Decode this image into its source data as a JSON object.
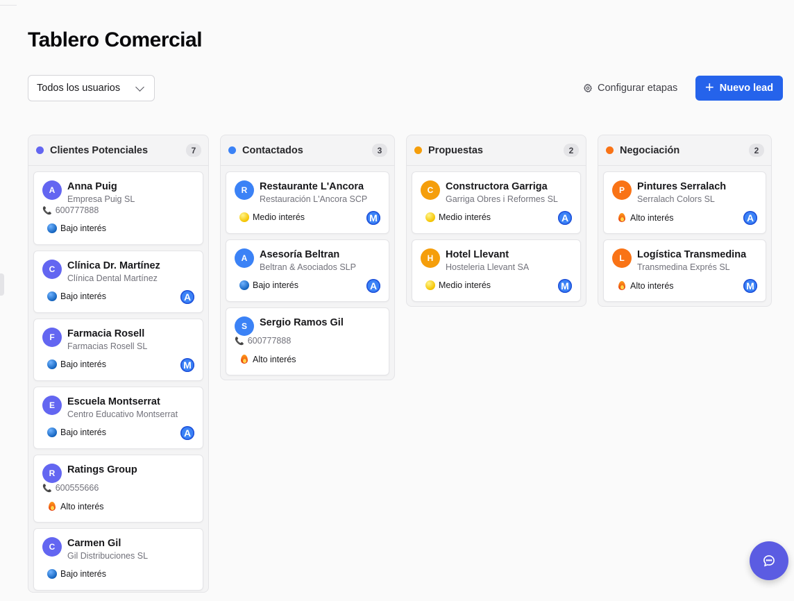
{
  "page": {
    "title": "Tablero Comercial"
  },
  "toolbar": {
    "user_filter": "Todos los usuarios",
    "configure_label": "Configurar etapas",
    "new_lead_label": "Nuevo lead"
  },
  "colors": {
    "primary": "#2563eb",
    "stage_prospects": "#6366f1",
    "stage_contacted": "#3b82f6",
    "stage_proposals": "#f59e0b",
    "stage_negotiation": "#f97316"
  },
  "columns": [
    {
      "title": "Clientes Potenciales",
      "count": "7",
      "cards": [
        {
          "initial": "A",
          "name": "Anna Puig",
          "company": "Empresa Puig SL",
          "phone": "600777888",
          "interest": "Bajo interés",
          "interest_icon": "blue-circle",
          "owner": ""
        },
        {
          "initial": "C",
          "name": "Clínica Dr. Martínez",
          "company": "Clínica Dental Martínez",
          "phone": "",
          "interest": "Bajo interés",
          "interest_icon": "blue-circle",
          "owner": "A"
        },
        {
          "initial": "F",
          "name": "Farmacia Rosell",
          "company": "Farmacias Rosell SL",
          "phone": "",
          "interest": "Bajo interés",
          "interest_icon": "blue-circle",
          "owner": "M"
        },
        {
          "initial": "E",
          "name": "Escuela Montserrat",
          "company": "Centro Educativo Montserrat",
          "phone": "",
          "interest": "Bajo interés",
          "interest_icon": "blue-circle",
          "owner": "A"
        },
        {
          "initial": "R",
          "name": "Ratings Group",
          "company": "",
          "phone": "600555666",
          "interest": "Alto interés",
          "interest_icon": "fire",
          "owner": ""
        },
        {
          "initial": "C",
          "name": "Carmen Gil",
          "company": "Gil Distribuciones SL",
          "phone": "",
          "interest": "Bajo interés",
          "interest_icon": "blue-circle",
          "owner": ""
        }
      ]
    },
    {
      "title": "Contactados",
      "count": "3",
      "cards": [
        {
          "initial": "R",
          "name": "Restaurante L'Ancora",
          "company": "Restauración L'Ancora SCP",
          "phone": "",
          "interest": "Medio interés",
          "interest_icon": "yellow-circle",
          "owner": "M"
        },
        {
          "initial": "A",
          "name": "Asesoría Beltran",
          "company": "Beltran & Asociados SLP",
          "phone": "",
          "interest": "Bajo interés",
          "interest_icon": "blue-circle",
          "owner": "A"
        },
        {
          "initial": "S",
          "name": "Sergio Ramos Gil",
          "company": "",
          "phone": "600777888",
          "interest": "Alto interés",
          "interest_icon": "fire",
          "owner": ""
        }
      ]
    },
    {
      "title": "Propuestas",
      "count": "2",
      "cards": [
        {
          "initial": "C",
          "name": "Constructora Garriga",
          "company": "Garriga Obres i Reformes SL",
          "phone": "",
          "interest": "Medio interés",
          "interest_icon": "yellow-circle",
          "owner": "A"
        },
        {
          "initial": "H",
          "name": "Hotel Llevant",
          "company": "Hosteleria Llevant SA",
          "phone": "",
          "interest": "Medio interés",
          "interest_icon": "yellow-circle",
          "owner": "M"
        }
      ]
    },
    {
      "title": "Negociación",
      "count": "2",
      "cards": [
        {
          "initial": "P",
          "name": "Pintures Serralach",
          "company": "Serralach Colors SL",
          "phone": "",
          "interest": "Alto interés",
          "interest_icon": "fire",
          "owner": "A"
        },
        {
          "initial": "L",
          "name": "Logística Transmedina",
          "company": "Transmedina Exprés SL",
          "phone": "",
          "interest": "Alto interés",
          "interest_icon": "fire",
          "owner": "M"
        }
      ]
    }
  ]
}
